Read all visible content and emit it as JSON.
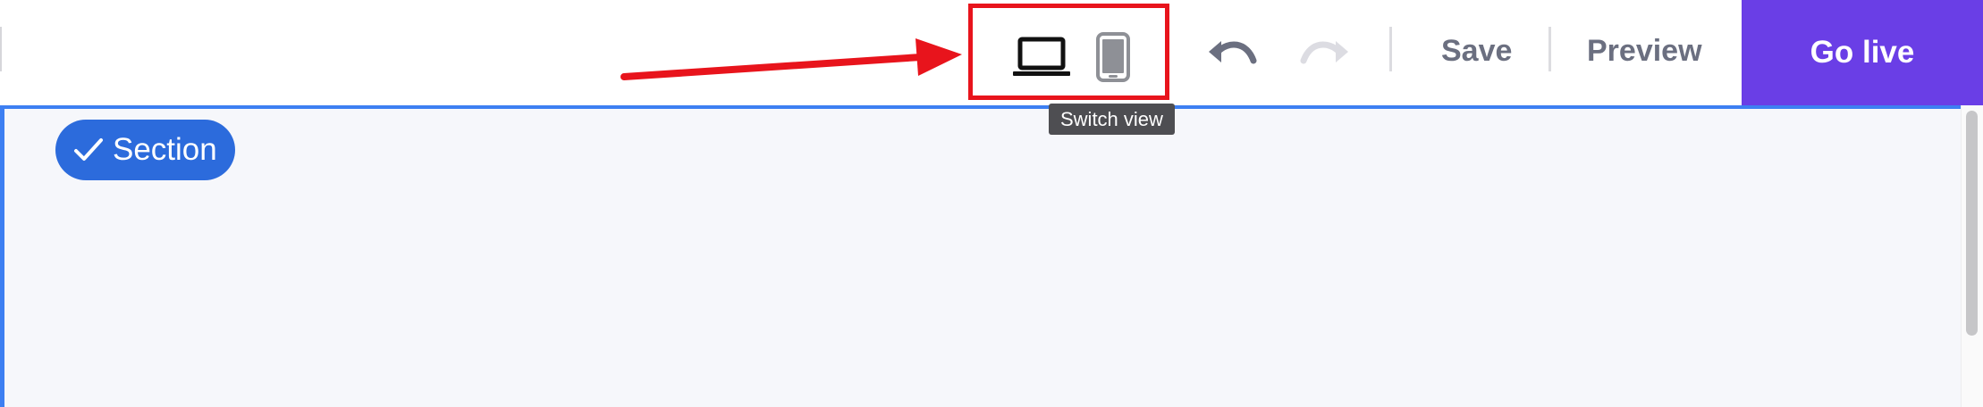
{
  "toolbar": {
    "view_switch": {
      "devices": [
        {
          "name": "desktop",
          "icon": "laptop-icon",
          "active": true
        },
        {
          "name": "mobile",
          "icon": "phone-icon",
          "active": false
        }
      ],
      "tooltip": "Switch view"
    },
    "undo_icon": "undo-icon",
    "redo_icon": "redo-icon",
    "save_label": "Save",
    "preview_label": "Preview",
    "go_live_label": "Go live"
  },
  "canvas": {
    "section_badge_label": "Section",
    "section_badge_icon": "check-icon"
  },
  "colors": {
    "accent": "#6a3ee6",
    "selection_blue": "#3d7ff2",
    "badge_blue": "#2c6bdc",
    "annotation_red": "#e8141c",
    "muted_text": "#6b6f80"
  }
}
